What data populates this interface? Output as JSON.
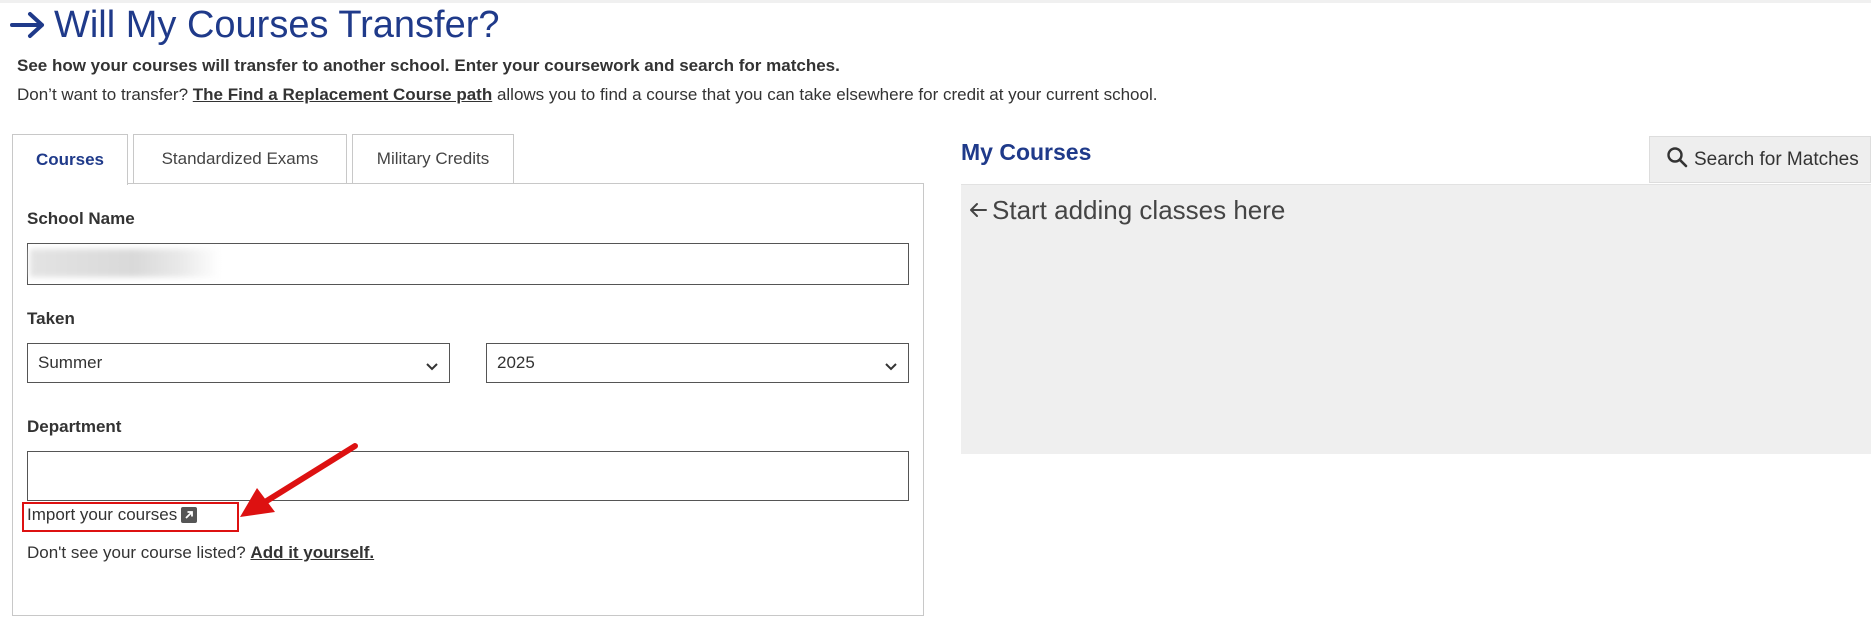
{
  "header": {
    "title": "Will My Courses Transfer?",
    "intro_bold": "See how your courses will transfer to another school. Enter your coursework and search for matches.",
    "intro_prefix": "Don’t want to transfer? ",
    "intro_link": "The Find a Replacement Course path",
    "intro_suffix": " allows you to find a course that you can take elsewhere for credit at your current school."
  },
  "tabs": [
    {
      "label": "Courses",
      "active": true
    },
    {
      "label": "Standardized Exams",
      "active": false
    },
    {
      "label": "Military Credits",
      "active": false
    }
  ],
  "form": {
    "school_name_label": "School Name",
    "school_name_value": "",
    "taken_label": "Taken",
    "term_value": "Summer",
    "year_value": "2025",
    "department_label": "Department",
    "department_value": "",
    "import_label": "Import your courses",
    "not_listed_text": "Don't see your course listed? ",
    "add_link": "Add it yourself."
  },
  "my_courses": {
    "title": "My Courses",
    "search_button": "Search for Matches",
    "empty_text": "Start adding classes here"
  },
  "colors": {
    "brand_blue": "#1f3a8a",
    "annotation_red": "#dd1111",
    "panel_gray": "#efefef"
  },
  "icons": [
    "arrow-right-icon",
    "chevron-down-icon",
    "external-link-icon",
    "search-icon",
    "arrow-left-icon"
  ]
}
